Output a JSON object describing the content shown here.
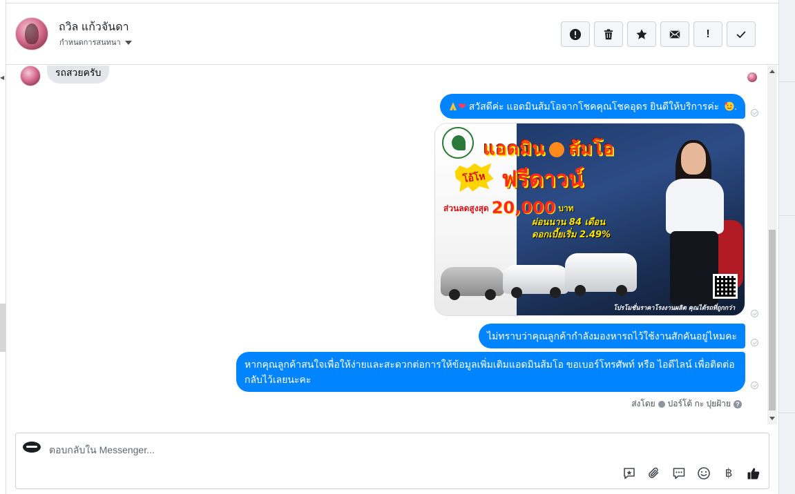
{
  "header": {
    "contact_name": "ถวิล แก้วจันดา",
    "assign_label": "กำหนดการสนทนา",
    "toolbar": [
      {
        "name": "report-spam-button",
        "icon": "alert-circle-icon"
      },
      {
        "name": "delete-button",
        "icon": "trash-icon"
      },
      {
        "name": "star-button",
        "icon": "star-icon"
      },
      {
        "name": "mark-unread-button",
        "icon": "envelope-icon"
      },
      {
        "name": "follow-up-button",
        "icon": "exclamation-icon",
        "label": "!"
      },
      {
        "name": "mark-done-button",
        "icon": "check-icon"
      }
    ]
  },
  "thread": {
    "incoming_message": "รถสวยครับ",
    "outgoing_1": "สวัสดีค่ะ แอดมินส้มโอจากโชคคุณโชคอุดร ยินดีให้บริการค่ะ",
    "outgoing_1_end": ".",
    "outgoing_3": "ไม่ทราบว่าคุณลูกค้ากำลังมองหารถไว้ใช้งานสักคันอยู่ไหมคะ",
    "outgoing_4": "หากคุณลูกค้าสนใจเพื่อให้ง่ายและสะดวกต่อการให้ข้อมูลเพิ่มเติมแอดมินส้มโอ ขอเบอร์โทรศัพท์ หรือ ไอดีไลน์ เพื่อติดต่อกลับไว้เลยนะคะ",
    "sent_by_prefix": "ส่งโดย",
    "sent_by_name": "ปอร์โต้ กะ ปุยฝ้าย",
    "sent_by_help": "?"
  },
  "promo_image": {
    "title_left": "แอดมิน",
    "title_right": "ส้มโอ",
    "burst": "โอ้โห",
    "headline": "ฟรีดาวน์",
    "discount_label": "ส่วนลดสูงสุด",
    "discount_amount": "20,000",
    "discount_unit": "บาท",
    "term": "ผ่อนนาน 84 เดือน",
    "rate": "ดอกเบี้ยเริ่ม 2.49%",
    "footer": "โปรโมชั่นราคาโรงงานผลิต คุณได้รถที่ถูกกว่า",
    "colors": {
      "headline": "#ff2a1a",
      "highlight": "#ffe600",
      "backdrop": "#1f3a6a"
    }
  },
  "composer": {
    "placeholder": "ตอบกลับใน Messenger...",
    "tools": [
      "saved-reply-icon",
      "paperclip-icon",
      "speech-bubble-icon",
      "smiley-icon",
      "baht-icon",
      "thumbs-up-icon"
    ],
    "baht_symbol": "฿"
  },
  "colors": {
    "outgoing_bubble": "#0084ff",
    "incoming_bubble": "#e4e6eb"
  }
}
